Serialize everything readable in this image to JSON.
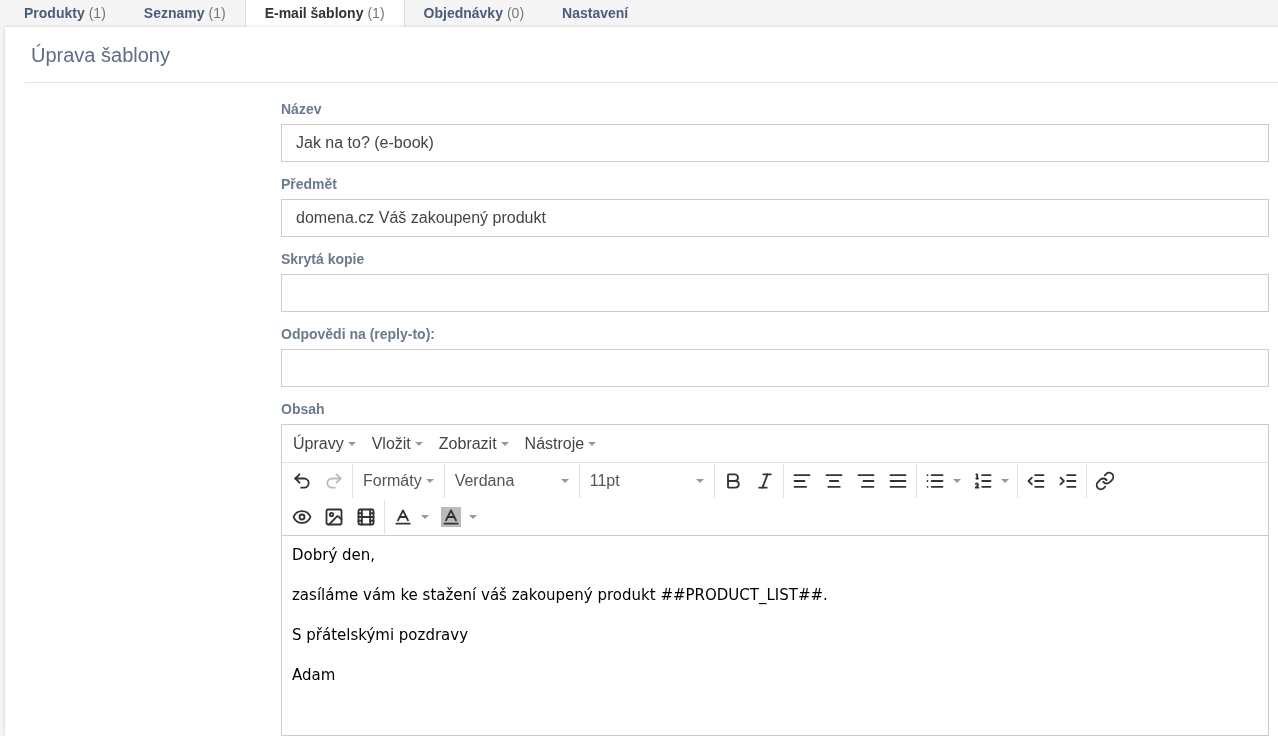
{
  "tabs": [
    {
      "label": "Produkty",
      "count": "(1)",
      "selected": false
    },
    {
      "label": "Seznamy",
      "count": "(1)",
      "selected": false
    },
    {
      "label": "E-mail šablony",
      "count": "(1)",
      "selected": true
    },
    {
      "label": "Objednávky",
      "count": "(0)",
      "selected": false
    },
    {
      "label": "Nastavení",
      "selected": false
    }
  ],
  "panel": {
    "title": "Úprava šablony",
    "fields": [
      {
        "label": "Název",
        "value": "Jak na to? (e-book)"
      },
      {
        "label": "Předmět",
        "value": "domena.cz Váš zakoupený produkt"
      },
      {
        "label": "Skrytá kopie"
      },
      {
        "label": "Odpovědi na (reply-to):"
      }
    ],
    "editor": {
      "label": "Obsah",
      "menu": [
        "Úpravy",
        "Vložit",
        "Zobrazit",
        "Nástroje"
      ],
      "toolbar_rows": [
        [
          [
            {
              "kind": "undo",
              "disabled": false
            },
            {
              "kind": "redo",
              "disabled": true
            }
          ],
          [
            {
              "kind": "menu",
              "text": "Formáty"
            }
          ],
          [
            {
              "kind": "select",
              "text": "Verdana"
            }
          ],
          [
            {
              "kind": "select",
              "text": "11pt"
            }
          ],
          [
            {
              "kind": "bold",
              "disabled": false
            },
            {
              "kind": "italic",
              "disabled": false
            }
          ],
          [
            {
              "kind": "align-left",
              "disabled": false
            },
            {
              "kind": "align-center",
              "disabled": false
            },
            {
              "kind": "align-right",
              "disabled": false
            },
            {
              "kind": "align-justify",
              "disabled": false
            }
          ],
          [
            {
              "kind": "bullet-list",
              "disabled": false
            },
            {
              "kind": "numbered-list",
              "disabled": false
            }
          ],
          [
            {
              "kind": "outdent",
              "disabled": false
            },
            {
              "kind": "indent",
              "disabled": false
            }
          ],
          [
            {
              "kind": "link",
              "disabled": false
            }
          ]
        ],
        [
          [
            {
              "kind": "preview",
              "disabled": false
            },
            {
              "kind": "image",
              "disabled": false
            },
            {
              "kind": "video",
              "disabled": false
            }
          ],
          [
            {
              "kind": "text-color",
              "disabled": false
            },
            {
              "kind": "background-color",
              "disabled": false
            }
          ]
        ]
      ],
      "content": [
        "Dobrý den,",
        "zasíláme vám ke stažení váš zakoupený produkt ##PRODUCT_LIST##.",
        "S přátelskými pozdravy",
        "Adam"
      ]
    }
  }
}
